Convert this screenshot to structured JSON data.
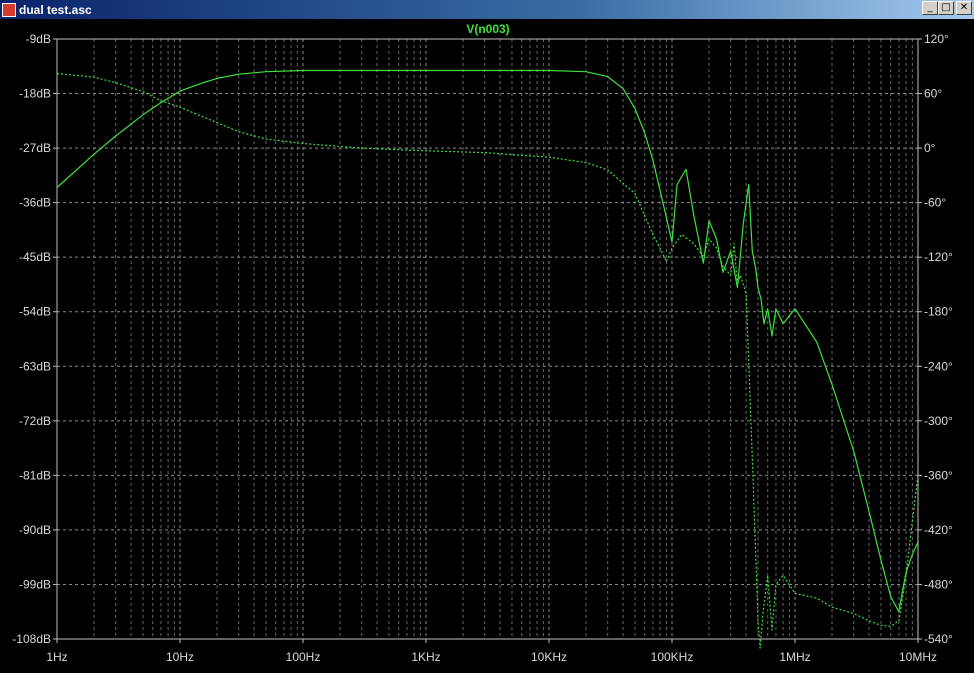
{
  "window": {
    "title": "dual test.asc",
    "buttons": {
      "minimize": "_",
      "maximize": "□",
      "close": "✕"
    }
  },
  "chart_data": {
    "type": "line",
    "title": "V(n003)",
    "xscale": "log",
    "x_ticks": [
      "1Hz",
      "10Hz",
      "100Hz",
      "1KHz",
      "10KHz",
      "100KHz",
      "1MHz",
      "10MHz"
    ],
    "x_range_hz": [
      1,
      10000000
    ],
    "y_left_ticks": [
      "-9dB",
      "-18dB",
      "-27dB",
      "-36dB",
      "-45dB",
      "-54dB",
      "-63dB",
      "-72dB",
      "-81dB",
      "-90dB",
      "-99dB",
      "-108dB"
    ],
    "y_left_range_db": [
      -108,
      -9
    ],
    "y_right_ticks": [
      "120°",
      "60°",
      "0°",
      "-60°",
      "-120°",
      "-180°",
      "-240°",
      "-300°",
      "-360°",
      "-420°",
      "-480°",
      "-540°"
    ],
    "y_right_range_deg": [
      -540,
      120
    ],
    "grid": true,
    "colors": {
      "trace": "#3ee03e",
      "grid": "#8a8a8a",
      "background": "#000000",
      "axis_text": "#d8d8d8",
      "title": "#3ee03e"
    },
    "series": [
      {
        "kind": "magnitude",
        "axis": "left",
        "style": "solid",
        "x": [
          1,
          2,
          3,
          5,
          7,
          10,
          15,
          20,
          30,
          50,
          100,
          300,
          1000,
          3000,
          10000,
          20000,
          30000,
          40000,
          50000,
          60000,
          70000,
          80000,
          90000,
          100000,
          110000,
          130000,
          150000,
          180000,
          200000,
          230000,
          260000,
          300000,
          340000,
          380000,
          420000,
          450000,
          480000,
          500000,
          530000,
          560000,
          600000,
          650000,
          700000,
          800000,
          1000000,
          1500000,
          2000000,
          3000000,
          4000000,
          5000000,
          6000000,
          7000000,
          7500000,
          8000000,
          9000000,
          10000000
        ],
        "y": [
          -33.5,
          -28,
          -25,
          -21.5,
          -19.5,
          -17.6,
          -16.3,
          -15.5,
          -14.8,
          -14.4,
          -14.2,
          -14.2,
          -14.2,
          -14.2,
          -14.2,
          -14.4,
          -15.2,
          -17.2,
          -20.5,
          -24.5,
          -29,
          -34,
          -38.5,
          -42.5,
          -33,
          -30.5,
          -38,
          -46,
          -39,
          -42,
          -47.5,
          -44,
          -50,
          -39.5,
          -33,
          -44,
          -47,
          -50,
          -52,
          -56,
          -53.5,
          -58,
          -53.5,
          -56,
          -53.5,
          -59,
          -66,
          -77,
          -87,
          -95,
          -101,
          -103.5,
          -100,
          -97,
          -94,
          -92
        ]
      },
      {
        "kind": "phase",
        "axis": "right",
        "style": "dashed",
        "x": [
          1,
          2,
          3,
          5,
          7,
          10,
          15,
          20,
          30,
          50,
          100,
          300,
          1000,
          3000,
          10000,
          20000,
          30000,
          50000,
          70000,
          80000,
          90000,
          100000,
          120000,
          150000,
          180000,
          200000,
          230000,
          260000,
          300000,
          320000,
          340000,
          360000,
          400000,
          450000,
          480000,
          500000,
          520000,
          550000,
          600000,
          650000,
          700000,
          800000,
          1000000,
          1500000,
          2000000,
          3000000,
          4000000,
          5000000,
          6000000,
          7000000,
          8000000,
          9000000,
          10000000
        ],
        "y": [
          82,
          78,
          72,
          62,
          52,
          45,
          35,
          28,
          18,
          10,
          5,
          0,
          -3,
          -5,
          -10,
          -16,
          -24,
          -50,
          -95,
          -110,
          -125,
          -110,
          -95,
          -105,
          -120,
          -100,
          -110,
          -130,
          -140,
          -105,
          -150,
          -140,
          -160,
          -340,
          -450,
          -520,
          -550,
          -510,
          -470,
          -530,
          -480,
          -470,
          -490,
          -495,
          -505,
          -512,
          -520,
          -525,
          -526,
          -520,
          -470,
          -410,
          -360
        ]
      }
    ]
  }
}
